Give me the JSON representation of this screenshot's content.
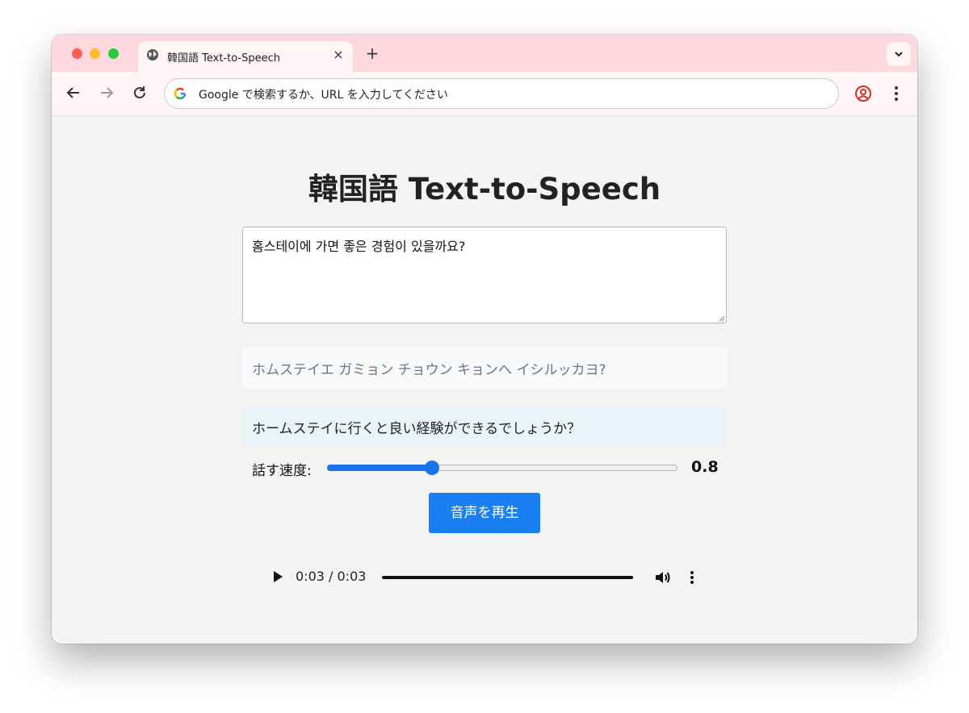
{
  "browser": {
    "tab": {
      "title": "韓国語 Text-to-Speech",
      "close_icon": "×"
    },
    "new_tab_icon": "+",
    "omnibox": {
      "placeholder": "Google で検索するか、URL を入力してください"
    }
  },
  "page": {
    "title": "韓国語 Text-to-Speech",
    "korean_text": "홈스테이에 가면 좋은 경험이 있을까요?",
    "pronunciation": "ホムステイエ ガミョン チョウン キョンへ イシルッカヨ?",
    "translation": "ホームステイに行くと良い経験ができるでしょうか？",
    "speed": {
      "label": "話す速度:",
      "value": 0.8,
      "value_text": "0.8",
      "min": 0.5,
      "max": 1.5
    },
    "play_button_label": "音声を再生",
    "audio": {
      "time": "0:03 / 0:03",
      "progress": 1.0
    }
  },
  "colors": {
    "tab_bar": "#fdd8de",
    "accent": "#1a73e8",
    "button": "#1a7ff0",
    "translation_bg": "#e8f4f8"
  }
}
